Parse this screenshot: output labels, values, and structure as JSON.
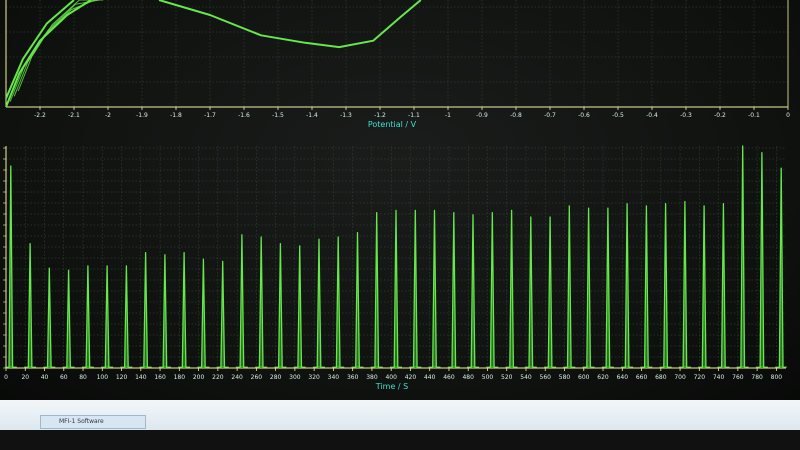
{
  "colors": {
    "trace": "#66e84a",
    "axis": "#f5f0a0",
    "grid": "#3a4a3f",
    "axis_title": "#3fe0d0",
    "tick": "#d9f0e4"
  },
  "taskbar": {
    "task_label": "MFI-1 Software"
  },
  "chart_data": [
    {
      "type": "line",
      "title": "",
      "xlabel": "Potential / V",
      "ylabel": "",
      "xlim": [
        -2.3,
        0
      ],
      "ylim": [
        0,
        1
      ],
      "grid": true,
      "x_ticks": [
        "-2.2",
        "-2.1",
        "-2",
        "-1.9",
        "-1.8",
        "-1.7",
        "-1.6",
        "-1.5",
        "-1.4",
        "-1.3",
        "-1.2",
        "-1.1",
        "-1",
        "-0.9",
        "-0.8",
        "-0.7",
        "-0.6",
        "-0.5",
        "-0.4",
        "-0.3",
        "-0.2",
        "-0.1",
        "0"
      ],
      "series": [
        {
          "values_xy": [
            [
              -2.3,
              0.0
            ],
            [
              -2.26,
              0.32
            ],
            [
              -2.2,
              0.62
            ],
            [
              -2.12,
              0.86
            ],
            [
              -2.05,
              1.0
            ]
          ],
          "values_xy_2": [
            [
              -2.3,
              0.08
            ],
            [
              -2.25,
              0.45
            ],
            [
              -2.18,
              0.78
            ],
            [
              -2.1,
              1.0
            ]
          ],
          "values_xy_3": [
            [
              -1.85,
              1.0
            ],
            [
              -1.7,
              0.86
            ],
            [
              -1.55,
              0.67
            ],
            [
              -1.42,
              0.6
            ],
            [
              -1.32,
              0.56
            ],
            [
              -1.22,
              0.62
            ],
            [
              -1.14,
              0.84
            ],
            [
              -1.08,
              1.0
            ]
          ]
        }
      ]
    },
    {
      "type": "bar",
      "title": "",
      "xlabel": "Time / S",
      "ylabel": "",
      "xlim": [
        0,
        810
      ],
      "ylim": [
        0,
        1
      ],
      "grid": true,
      "x_ticks": [
        "0",
        "20",
        "40",
        "60",
        "80",
        "100",
        "120",
        "140",
        "160",
        "180",
        "200",
        "220",
        "240",
        "260",
        "280",
        "300",
        "320",
        "340",
        "360",
        "380",
        "400",
        "420",
        "440",
        "460",
        "480",
        "500",
        "520",
        "540",
        "560",
        "580",
        "600",
        "620",
        "640",
        "660",
        "680",
        "700",
        "720",
        "740",
        "760",
        "780",
        "800"
      ],
      "times": [
        5,
        25,
        45,
        65,
        85,
        105,
        125,
        145,
        165,
        185,
        205,
        225,
        245,
        265,
        285,
        305,
        325,
        345,
        365,
        385,
        405,
        425,
        445,
        465,
        485,
        505,
        525,
        545,
        565,
        585,
        605,
        625,
        645,
        665,
        685,
        705,
        725,
        745,
        765,
        785,
        805
      ],
      "values": [
        0.91,
        0.56,
        0.45,
        0.44,
        0.46,
        0.46,
        0.46,
        0.52,
        0.51,
        0.52,
        0.49,
        0.48,
        0.6,
        0.59,
        0.56,
        0.55,
        0.58,
        0.59,
        0.61,
        0.7,
        0.71,
        0.71,
        0.71,
        0.7,
        0.69,
        0.7,
        0.71,
        0.68,
        0.68,
        0.73,
        0.72,
        0.72,
        0.74,
        0.73,
        0.74,
        0.75,
        0.73,
        0.74,
        1.0,
        0.97,
        0.9
      ]
    }
  ]
}
